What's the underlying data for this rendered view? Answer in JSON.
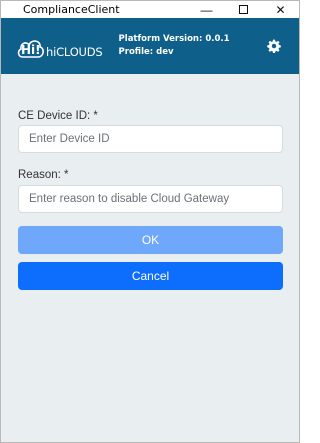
{
  "window": {
    "title": "ComplianceClient",
    "minimize_glyph": "—",
    "close_glyph": "✕"
  },
  "header": {
    "logo_text": "hiCLOUDS",
    "logo_mark": "Hi!",
    "platform_version": "Platform Version: 0.0.1",
    "profile": "Profile: dev",
    "background": "#0e5f8a",
    "settings_icon": "gear-icon"
  },
  "form": {
    "device_id": {
      "label": "CE Device ID: *",
      "placeholder": "Enter Device ID",
      "value": ""
    },
    "reason": {
      "label": "Reason: *",
      "placeholder": "Enter reason to disable Cloud Gateway",
      "value": ""
    },
    "ok_label": "OK",
    "cancel_label": "Cancel",
    "ok_color": "#6fa8fb",
    "cancel_color": "#0d6efd"
  }
}
